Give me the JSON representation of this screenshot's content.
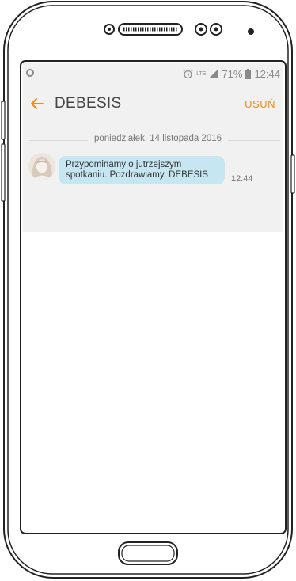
{
  "status_bar": {
    "lte_label": "LTE",
    "battery_percent": "71%",
    "time": "12:44"
  },
  "app_bar": {
    "title": "DEBESIS",
    "delete_label": "USUŃ"
  },
  "conversation": {
    "date_separator": "poniedziałek, 14 listopada 2016",
    "messages": [
      {
        "text": "Przypominamy o jutrzejszym\nspotkaniu. Pozdrawiamy, DEBESIS",
        "time": "12:44"
      }
    ]
  },
  "colors": {
    "accent": "#f08a1e",
    "bubble": "#c6e7f1",
    "header_bg": "#f1f1f1"
  },
  "icons": {
    "back": "arrow-left-icon",
    "alarm": "alarm-icon",
    "signal": "signal-icon",
    "battery": "battery-icon"
  }
}
